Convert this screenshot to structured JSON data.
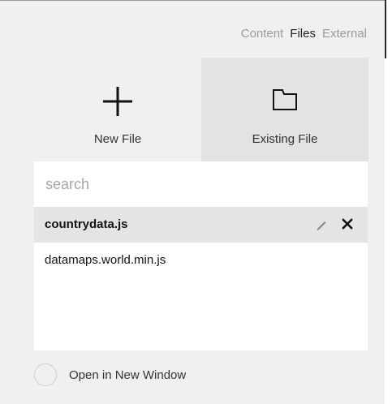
{
  "tabs": [
    {
      "label": "Content",
      "active": false
    },
    {
      "label": "Files",
      "active": true
    },
    {
      "label": "External",
      "active": false
    }
  ],
  "actions": {
    "new_file_label": "New File",
    "new_file_icon": "plus-icon",
    "existing_file_label": "Existing File",
    "existing_file_icon": "folder-icon"
  },
  "search": {
    "placeholder": "search",
    "value": ""
  },
  "files": [
    {
      "name": "countrydata.js",
      "selected": true
    },
    {
      "name": "datamaps.world.min.js",
      "selected": false
    }
  ],
  "row_actions": {
    "edit_icon": "pencil-icon",
    "delete_icon": "close-icon"
  },
  "open_in_new_window": {
    "label": "Open in New Window",
    "checked": false
  }
}
